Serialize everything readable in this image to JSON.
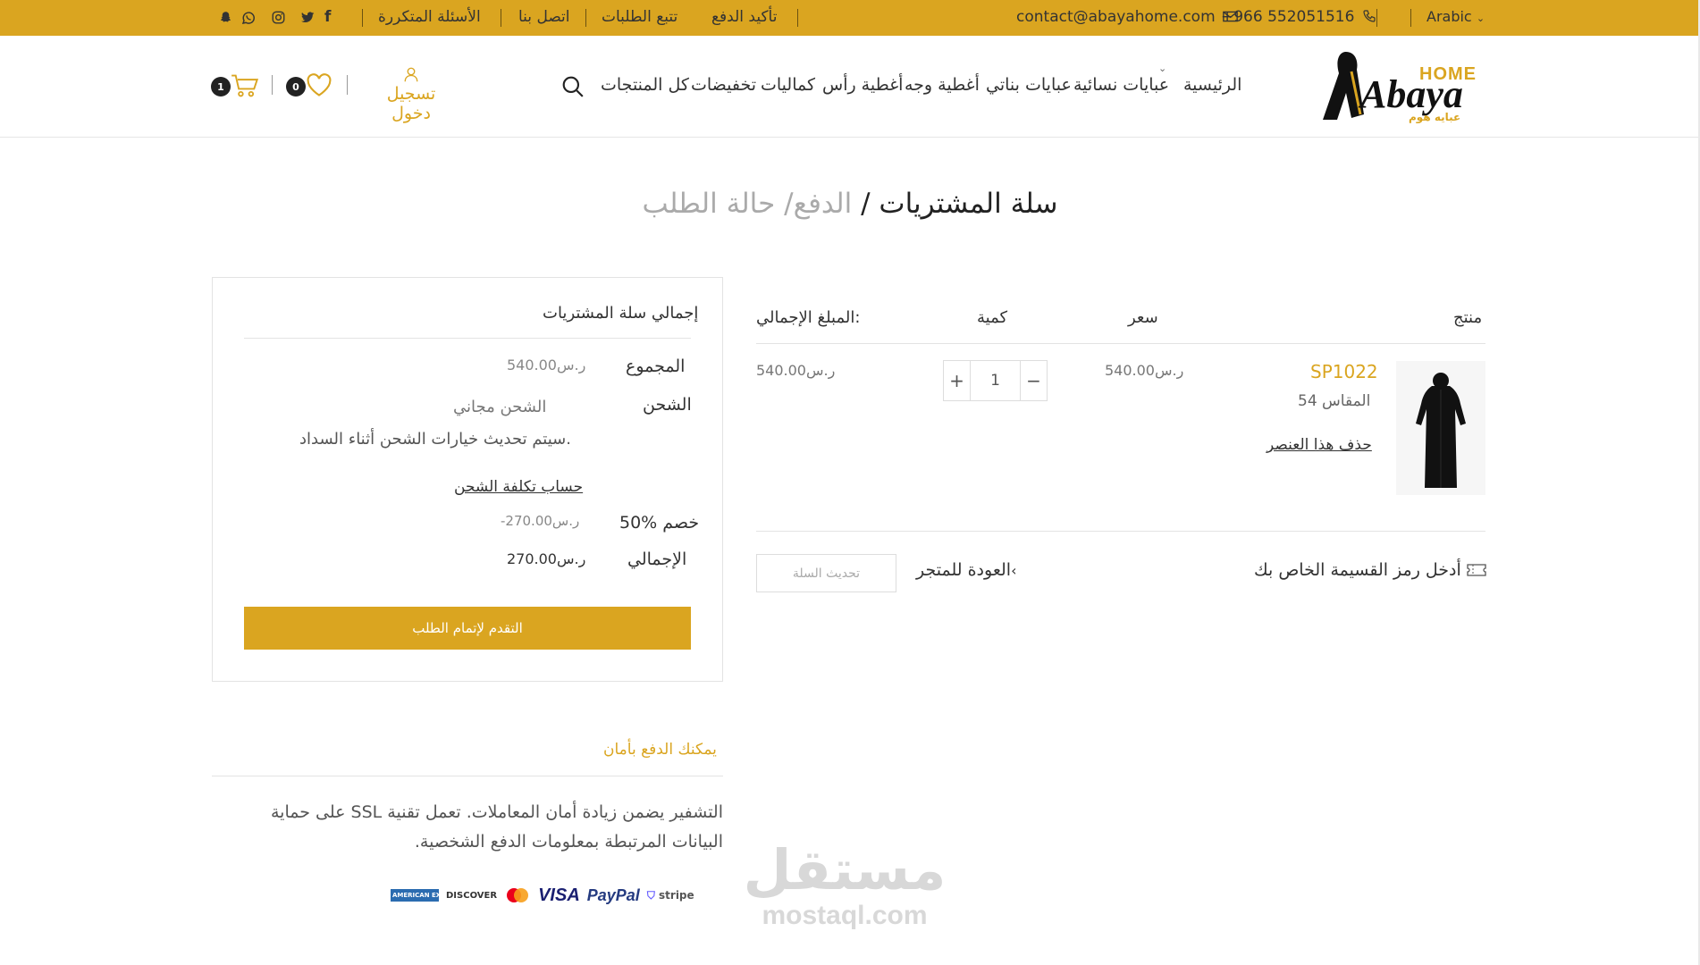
{
  "topbar": {
    "language": "Arabic",
    "phone": "+966 552051516",
    "email": "contact@abayahome.com",
    "links": [
      "تأكيد الدفع",
      "تتبع الطلبات",
      "اتصل بنا",
      "الأسئلة المتكررة"
    ],
    "social_icons": [
      "facebook-icon",
      "twitter-icon",
      "instagram-icon",
      "whatsapp-icon",
      "snapchat-icon"
    ]
  },
  "header": {
    "logo_main": "Abaya",
    "logo_home": "HOME",
    "logo_sub": "عبايه هوم",
    "nav": [
      "الرئيسية",
      "عبايات نسائية",
      "عبايات بناتي",
      "أغطية وجه",
      "أغطية رأس",
      "كماليات",
      "تخفيضات",
      "كل المنتجات"
    ],
    "login": "تسجيل دخول",
    "wishlist_count": "0",
    "cart_count": "1"
  },
  "breadcrumb": {
    "current": "سلة المشتريات",
    "sep": "/",
    "rest": "الدفع/ حالة الطلب"
  },
  "cart": {
    "headers": {
      "product": "منتج",
      "price": "سعر",
      "qty": "كمية",
      "total": "المبلغ الإجمالي:"
    },
    "item": {
      "sku": "SP1022",
      "size": "المقاس 54",
      "remove": "حذف هذا العنصر",
      "price": "ر.س540.00",
      "qty": "1",
      "total": "ر.س540.00"
    },
    "coupon": "أدخل رمز القسيمة الخاص بك",
    "back": "العودة للمتجر",
    "update": "تحديث السلة"
  },
  "summary": {
    "title": "إجمالي سلة المشتريات",
    "subtotal_label": "المجموع",
    "subtotal": "ر.س540.00",
    "shipping_label": "الشحن",
    "shipping_value": "الشحن مجاني",
    "shipping_note": "سيتم تحديث خيارات الشحن أثناء السداد.",
    "shipping_calc": "حساب تكلفة الشحن",
    "discount_label": "50% خصم",
    "discount": "-ر.س270.00",
    "total_label": "الإجمالي",
    "total": "ر.س270.00",
    "checkout": "التقدم لإتمام الطلب"
  },
  "secure": {
    "title": "يمكنك الدفع بأمان",
    "line1": "التشفير يضمن زيادة أمان المعاملات. تعمل تقنية SSL على حماية",
    "line2": "البيانات المرتبطة بمعلومات الدفع الشخصية.",
    "cards": [
      "AMERICAN EXPRESS",
      "DISCOVER",
      "mastercard",
      "VISA",
      "PayPal",
      "stripe"
    ]
  },
  "watermark": {
    "ar": "مستقل",
    "en": "mostaql.com"
  },
  "colors": {
    "accent": "#DAA520",
    "dark": "#222222"
  }
}
